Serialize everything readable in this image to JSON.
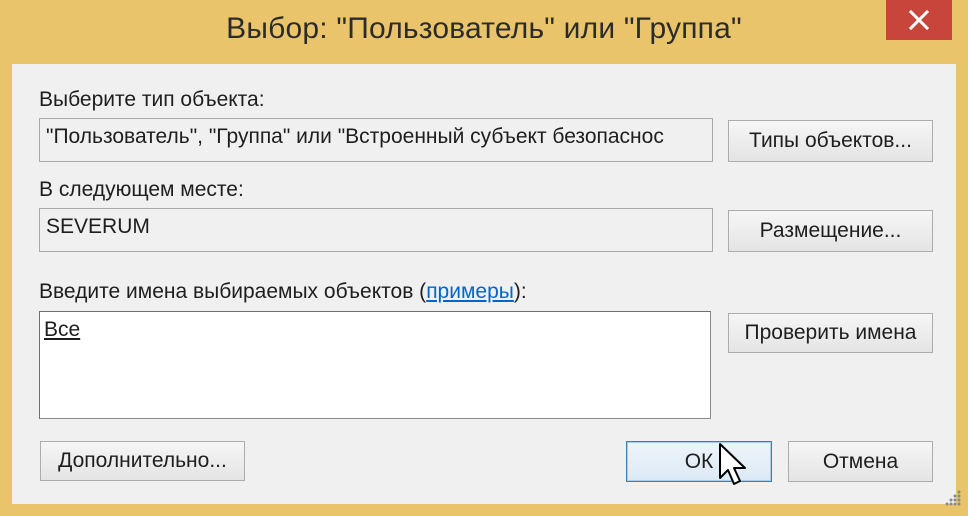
{
  "window": {
    "title": "Выбор: \"Пользователь\" или \"Группа\""
  },
  "object_type": {
    "label": "Выберите тип объекта:",
    "value": "\"Пользователь\", \"Группа\" или \"Встроенный субъект безопаснос",
    "button": "Типы объектов..."
  },
  "location": {
    "label": "В следующем месте:",
    "value": "SEVERUM",
    "button": "Размещение..."
  },
  "names": {
    "label_before": "Введите имена выбираемых объектов (",
    "label_link": "примеры",
    "label_after": "):",
    "value": "Все",
    "check_button": "Проверить имена"
  },
  "footer": {
    "advanced_button": "Дополнительно...",
    "ok_button": "ОК",
    "cancel_button": "Отмена"
  },
  "colors": {
    "title_bar": "#eac46a",
    "close_button": "#c7453a",
    "client_bg": "#f0f0f0",
    "link": "#0066cc",
    "default_button_border": "#3c7fb1"
  }
}
